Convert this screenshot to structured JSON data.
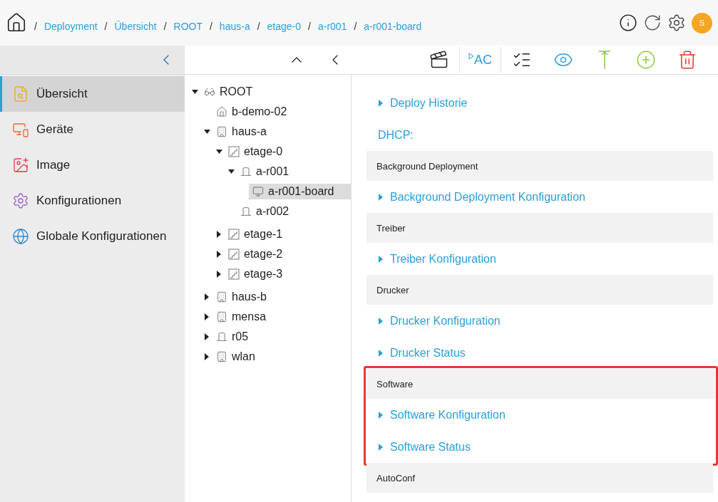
{
  "breadcrumb": [
    {
      "separator": "/",
      "label": "Deployment"
    },
    {
      "separator": "/",
      "label": "Übersicht"
    },
    {
      "separator": "/",
      "label": "ROOT"
    },
    {
      "separator": "/",
      "label": "haus-a"
    },
    {
      "separator": "/",
      "label": "etage-0"
    },
    {
      "separator": "/",
      "label": "a-r001"
    },
    {
      "separator": "/",
      "label": "a-r001-board"
    }
  ],
  "user": {
    "initial": "S"
  },
  "toolbar": [
    {
      "kind": "clapper"
    },
    {
      "kind": "autoconf",
      "label": "AC"
    },
    {
      "kind": "list"
    },
    {
      "kind": "eye"
    },
    {
      "kind": "upload"
    },
    {
      "kind": "add"
    },
    {
      "kind": "delete"
    }
  ],
  "sidebar": {
    "items": [
      {
        "label": "Übersicht",
        "kind": "overview",
        "selected": true
      },
      {
        "label": "Geräte",
        "kind": "devices",
        "selected": false
      },
      {
        "label": "Image",
        "kind": "image",
        "selected": false
      },
      {
        "label": "Konfigurationen",
        "kind": "config",
        "selected": false
      },
      {
        "label": "Globale Konfigurationen",
        "kind": "global",
        "selected": false
      }
    ]
  },
  "tree": [
    {
      "label": "ROOT",
      "kind": "root",
      "expanded": true,
      "selected": false,
      "children": [
        {
          "label": "b-demo-02",
          "kind": "site",
          "selected": false
        },
        {
          "label": "haus-a",
          "kind": "building",
          "expanded": true,
          "selected": false,
          "children": [
            {
              "label": "etage-0",
              "kind": "floor",
              "expanded": true,
              "selected": false,
              "children": [
                {
                  "label": "a-r001",
                  "kind": "room",
                  "expanded": true,
                  "selected": false,
                  "children": [
                    {
                      "label": "a-r001-board",
                      "kind": "board",
                      "selected": true
                    }
                  ]
                },
                {
                  "label": "a-r002",
                  "kind": "room",
                  "selected": false
                }
              ]
            },
            {
              "label": "etage-1",
              "kind": "floor",
              "expanded": false,
              "selected": false
            },
            {
              "label": "etage-2",
              "kind": "floor",
              "expanded": false,
              "selected": false
            },
            {
              "label": "etage-3",
              "kind": "floor",
              "expanded": false,
              "selected": false
            }
          ]
        },
        {
          "label": "haus-b",
          "kind": "building",
          "expanded": false,
          "selected": false
        },
        {
          "label": "mensa",
          "kind": "building",
          "expanded": false,
          "selected": false
        },
        {
          "label": "r05",
          "kind": "room",
          "expanded": false,
          "selected": false
        },
        {
          "label": "wlan",
          "kind": "building",
          "expanded": false,
          "selected": false
        }
      ]
    }
  ],
  "sections": [
    {
      "highlighted": false,
      "items": [
        {
          "kind": "link",
          "text": "Deploy Historie"
        },
        {
          "kind": "label",
          "text": "DHCP:"
        }
      ]
    },
    {
      "heading": "Background Deployment",
      "highlighted": false,
      "items": [
        {
          "kind": "link",
          "text": "Background Deployment Konfiguration"
        }
      ]
    },
    {
      "heading": "Treiber",
      "highlighted": false,
      "items": [
        {
          "kind": "link",
          "text": "Treiber Konfiguration"
        }
      ]
    },
    {
      "heading": "Drucker",
      "highlighted": false,
      "items": [
        {
          "kind": "link",
          "text": "Drucker Konfiguration"
        },
        {
          "kind": "link",
          "text": "Drucker Status"
        }
      ]
    },
    {
      "heading": "Software",
      "highlighted": true,
      "items": [
        {
          "kind": "link",
          "text": "Software Konfiguration"
        },
        {
          "kind": "link",
          "text": "Software Status"
        }
      ]
    },
    {
      "heading": "AutoConf",
      "highlighted": false
    }
  ]
}
